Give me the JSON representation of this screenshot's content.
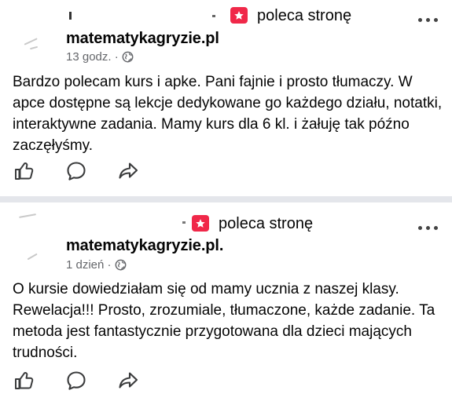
{
  "posts": [
    {
      "recommends_label": "poleca stronę",
      "page_name": "matematykagryzie.pl",
      "time": "13 godz. ·",
      "text": "Bardzo polecam kurs i apke. Pani fajnie i prosto tłumaczy. W apce dostępne są lekcje dedykowane go każdego działu, notatki, interaktywne zadania. Mamy kurs dla 6 kl. i żałuję tak późno zaczęłyśmy.",
      "actions": [
        "like",
        "comment",
        "share"
      ]
    },
    {
      "recommends_label": "poleca stronę",
      "page_name": "matematykagryzie.pl.",
      "time": "1 dzień ·",
      "text": "O kursie dowiedziałam się od mamy ucznia z naszej klasy. Rewelacja!!! Prosto, zrozumiale, tłumaczone, każde zadanie. Ta metoda jest fantastycznie przygotowana dla dzieci mających trudności.",
      "actions": [
        "like",
        "comment",
        "share"
      ]
    }
  ],
  "icons": {
    "recommend": "star-badge-icon",
    "more": "more-options-icon",
    "privacy": "globe-icon",
    "like": "like-icon",
    "comment": "comment-icon",
    "share": "share-icon"
  },
  "colors": {
    "recommend_badge": "#f02849",
    "separator": "#e4e6eb",
    "meta_text": "#65676b"
  }
}
